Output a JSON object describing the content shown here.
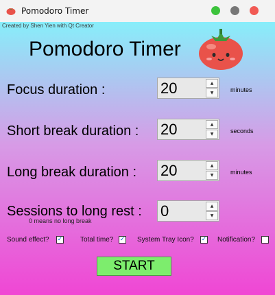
{
  "window": {
    "title": "Pomodoro Timer"
  },
  "header": {
    "credit": "Created by Shen Yien with Qt Creator",
    "title": "Pomodoro Timer"
  },
  "fields": [
    {
      "label": "Focus duration :",
      "value": "20",
      "unit": "minutes"
    },
    {
      "label": "Short break duration :",
      "value": "20",
      "unit": "seconds"
    },
    {
      "label": "Long break duration :",
      "value": "20",
      "unit": "minutes"
    },
    {
      "label": "Sessions to long rest :",
      "value": "0",
      "hint": "0 means no long break"
    }
  ],
  "options": [
    {
      "label": "Sound effect?",
      "checked": true
    },
    {
      "label": "Total time?",
      "checked": true
    },
    {
      "label": "System Tray Icon?",
      "checked": true
    },
    {
      "label": "Notification?",
      "checked": false
    }
  ],
  "actions": {
    "start_label": "START"
  },
  "colors": {
    "gradient_top": "#87eefa",
    "gradient_bottom": "#f046d4",
    "start_button": "#7ded6d",
    "tomato": "#e9524a"
  },
  "icons": {
    "app": "tomato-icon",
    "mascot": "tomato-mascot"
  }
}
